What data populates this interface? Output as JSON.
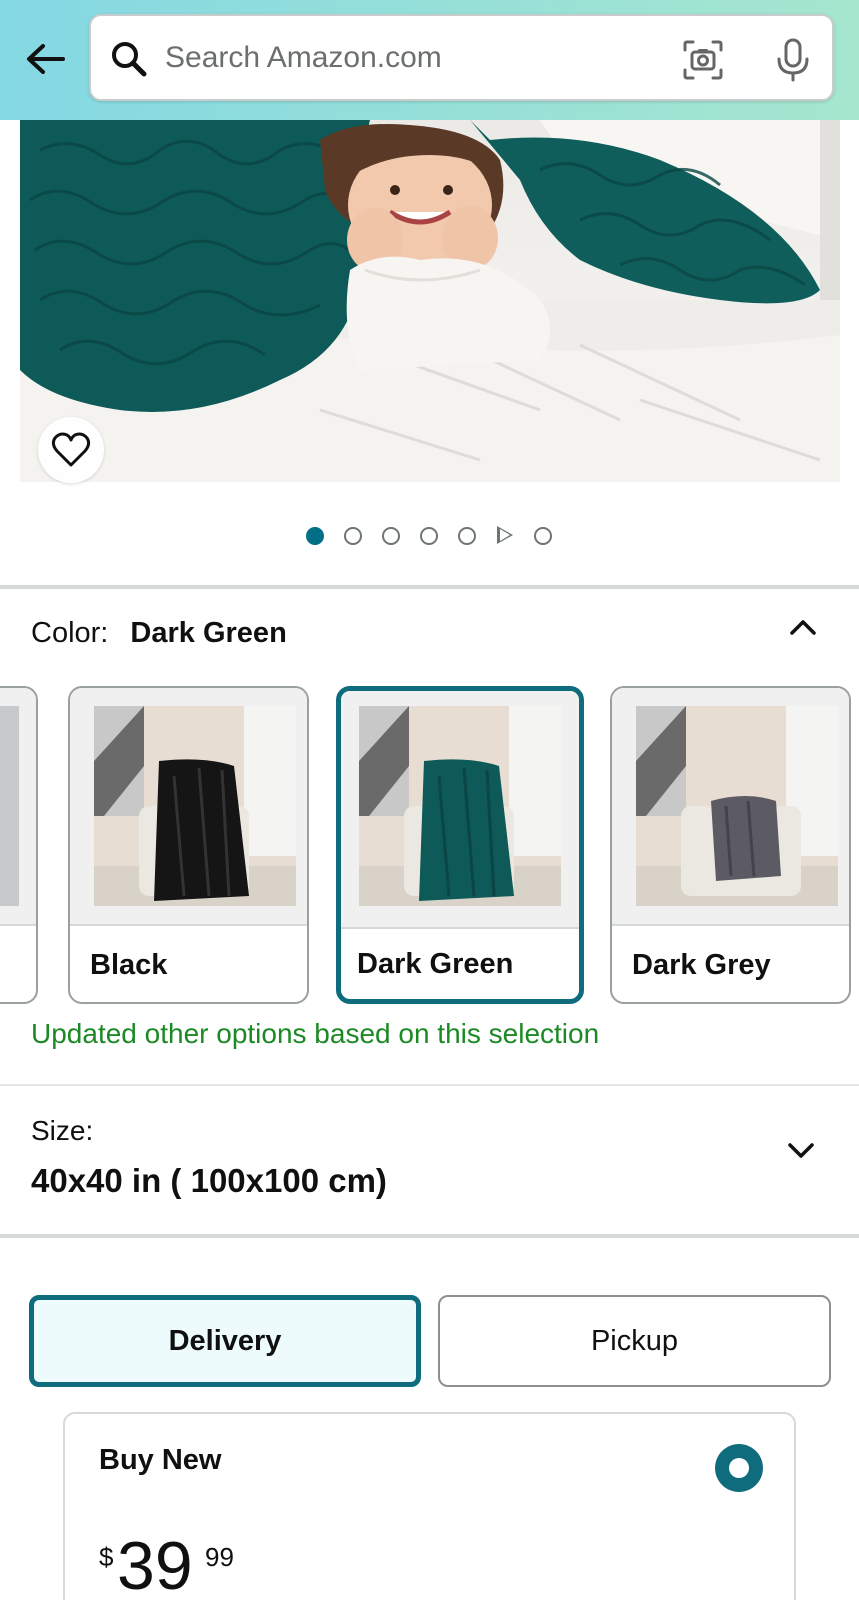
{
  "search": {
    "placeholder": "Search Amazon.com"
  },
  "pager": {
    "total_dots": 7,
    "active_index": 0,
    "video_index": 5
  },
  "color": {
    "label": "Color:",
    "selected": "Dark Green",
    "options": [
      {
        "label": "",
        "blanket_color": "#b8b9bd"
      },
      {
        "label": "Black",
        "blanket_color": "#151515"
      },
      {
        "label": "Dark Green",
        "blanket_color": "#0d5a58"
      },
      {
        "label": "Dark Grey",
        "blanket_color": "#5c5b63"
      }
    ],
    "update_note": "Updated other options based on this selection"
  },
  "size": {
    "label": "Size:",
    "value": "40x40 in ( 100x100 cm)"
  },
  "fulfillment": {
    "delivery_label": "Delivery",
    "pickup_label": "Pickup",
    "selected": "Delivery"
  },
  "buy_new": {
    "title": "Buy New",
    "currency": "$",
    "price_whole": "39",
    "price_fraction": "99"
  },
  "colors": {
    "accent": "#0e6c7d",
    "active_dot": "#007185",
    "success_text": "#1c8a24",
    "header_gradient_start": "#84d8e3",
    "header_gradient_end": "#a6e6ce"
  }
}
